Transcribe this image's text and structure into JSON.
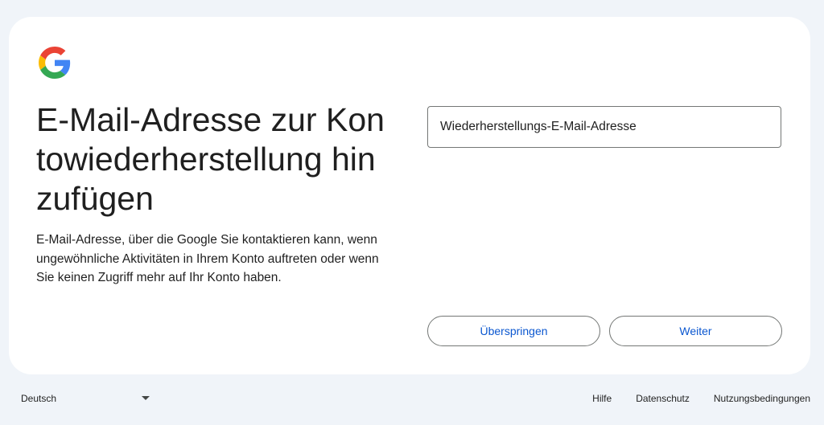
{
  "header": {
    "logo_icon": "google-g-logo-icon",
    "title": "E-Mail-Adresse zur Kontowiederherstellung hinzufügen",
    "description": "E-Mail-Adresse, über die Google Sie kontaktieren kann, wenn ungewöhnliche Aktivitäten in Ihrem Konto auftreten oder wenn Sie keinen Zugriff mehr auf Ihr Konto haben."
  },
  "form": {
    "recovery_email": {
      "label": "Wiederherstellungs-E-Mail-Adresse",
      "value": ""
    }
  },
  "actions": {
    "skip_label": "Überspringen",
    "next_label": "Weiter"
  },
  "footer": {
    "language": "Deutsch",
    "links": {
      "help": "Hilfe",
      "privacy": "Datenschutz",
      "terms": "Nutzungsbedingungen"
    }
  },
  "colors": {
    "page_background": "#f0f4f9",
    "card_background": "#ffffff",
    "button_text": "#0b57d0",
    "outline": "#747775",
    "google_blue": "#4285F4",
    "google_red": "#EA4335",
    "google_yellow": "#FBBC05",
    "google_green": "#34A853"
  }
}
